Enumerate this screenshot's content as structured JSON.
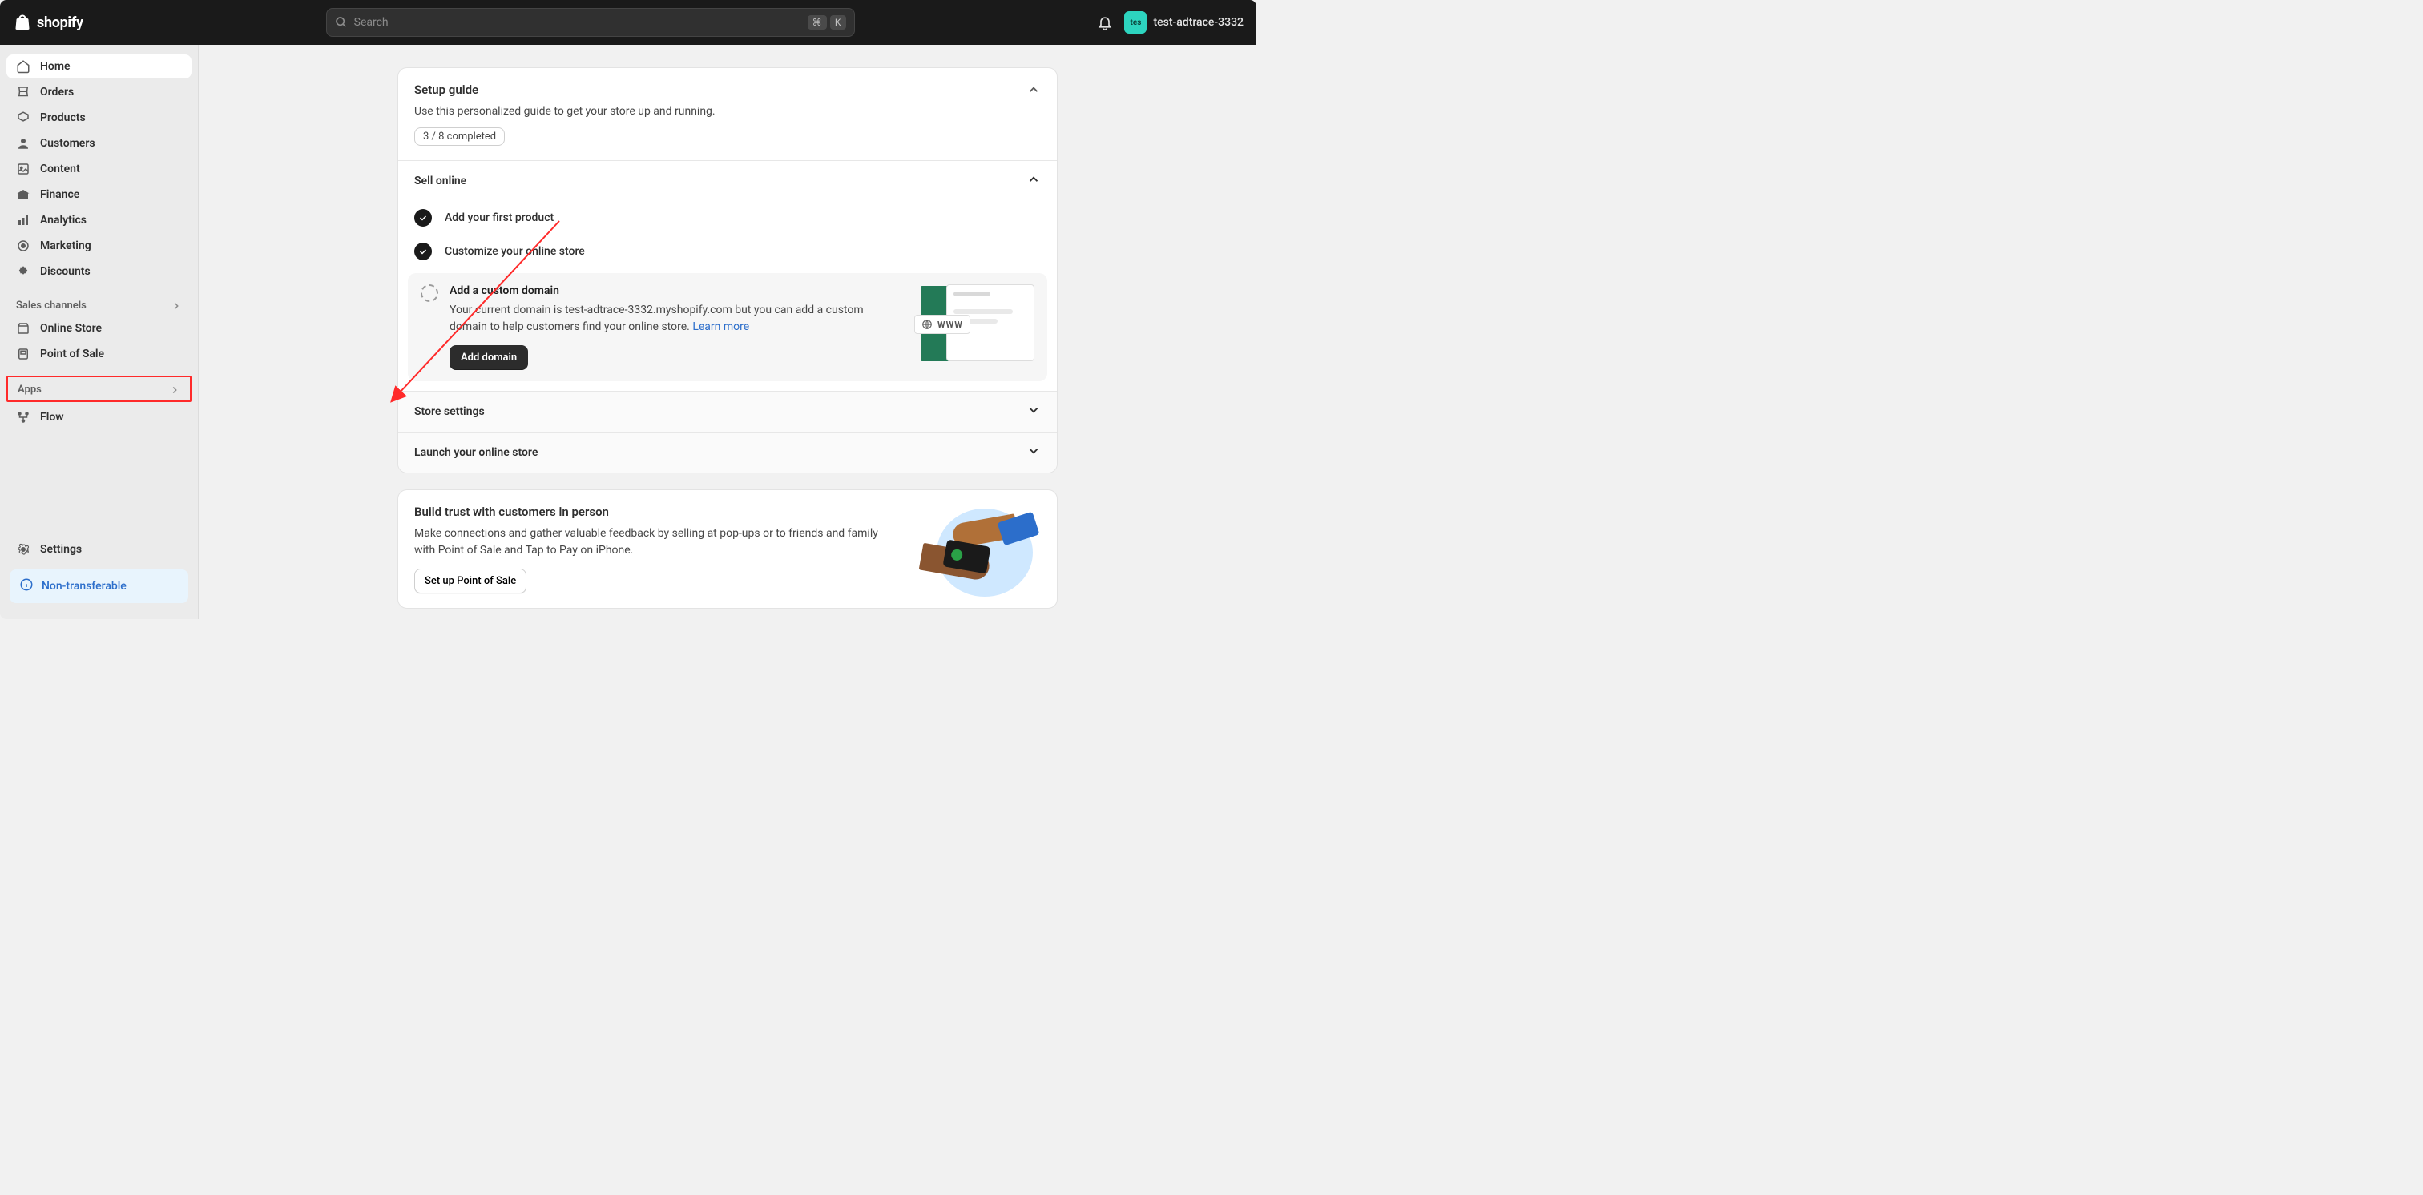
{
  "header": {
    "brand": "shopify",
    "search_placeholder": "Search",
    "kbd1": "⌘",
    "kbd2": "K",
    "store_avatar": "tes",
    "store_name": "test-adtrace-3332"
  },
  "sidebar": {
    "items": [
      {
        "label": "Home"
      },
      {
        "label": "Orders"
      },
      {
        "label": "Products"
      },
      {
        "label": "Customers"
      },
      {
        "label": "Content"
      },
      {
        "label": "Finance"
      },
      {
        "label": "Analytics"
      },
      {
        "label": "Marketing"
      },
      {
        "label": "Discounts"
      }
    ],
    "sales_channels_label": "Sales channels",
    "sales_channels": [
      {
        "label": "Online Store"
      },
      {
        "label": "Point of Sale"
      }
    ],
    "apps_label": "Apps",
    "apps": [
      {
        "label": "Flow"
      }
    ],
    "settings_label": "Settings",
    "non_transferable": "Non-transferable"
  },
  "setup_guide": {
    "title": "Setup guide",
    "subtitle": "Use this personalized guide to get your store up and running.",
    "progress_text": "3 / 8 completed",
    "section1_title": "Sell online",
    "task1": "Add your first product",
    "task2": "Customize your online store",
    "task3_title": "Add a custom domain",
    "task3_desc": "Your current domain is test-adtrace-3332.myshopify.com but you can add a custom domain to help customers find your online store. ",
    "task3_link": "Learn more",
    "task3_button": "Add domain",
    "thumb_chip": "WWW",
    "section2_title": "Store settings",
    "section3_title": "Launch your online store"
  },
  "trust_card": {
    "title": "Build trust with customers in person",
    "desc": "Make connections and gather valuable feedback by selling at pop-ups or to friends and family with Point of Sale and Tap to Pay on iPhone.",
    "button": "Set up Point of Sale"
  }
}
